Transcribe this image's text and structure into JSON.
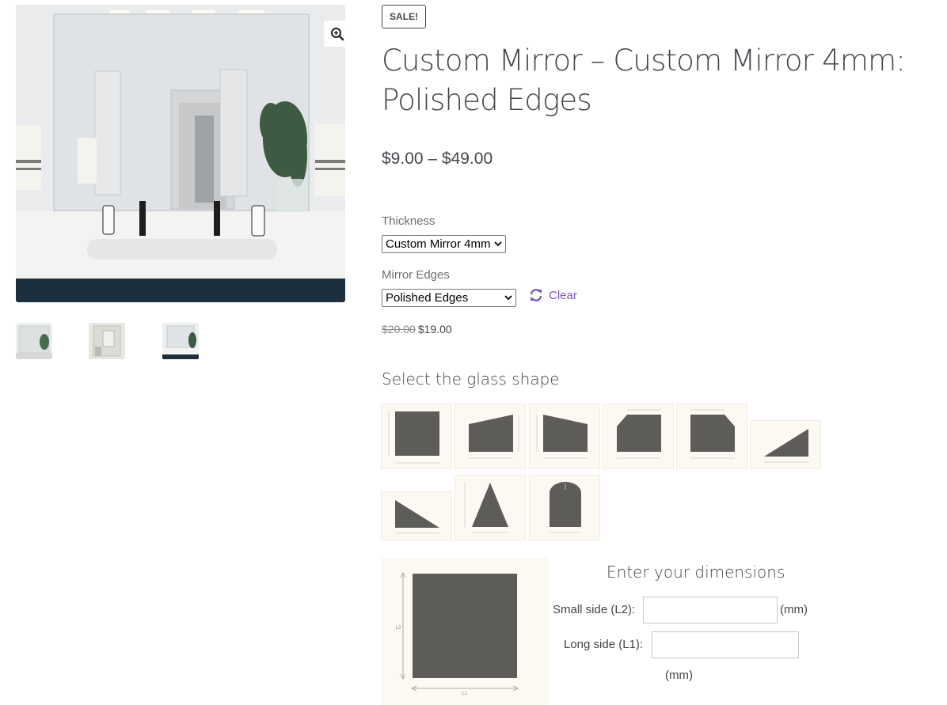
{
  "gallery": {
    "zoom_icon": "magnifier-plus-icon",
    "thumbnail_count": 3
  },
  "product": {
    "badge": "SALE!",
    "title": "Custom Mirror – Custom Mirror 4mm: Polished Edges",
    "price_range": "$9.00 – $49.00",
    "thickness_label": "Thickness",
    "thickness_value": "Custom Mirror 4mm",
    "edges_label": "Mirror Edges",
    "edges_value": "Polished Edges",
    "clear_label": "Clear",
    "clear_icon": "refresh-icon",
    "old_price": "$20.00",
    "new_price": "$19.00"
  },
  "shapes": {
    "heading": "Select the glass shape",
    "items": [
      "square",
      "trapezoid-left",
      "trapezoid-right",
      "cut-corner-left",
      "cut-corners-both",
      "triangle-right",
      "triangle-left",
      "triangle-isosceles",
      "arched"
    ]
  },
  "diagram": {
    "l1_label": "L1",
    "l2_label": "L2"
  },
  "dimensions": {
    "heading": "Enter your dimensions",
    "small_side_label": "Small side (L2):",
    "small_side_value": "",
    "long_side_label": "Long side (L1):",
    "long_side_value": "",
    "unit": "(mm)"
  },
  "colors": {
    "accent": "#7f54b3",
    "shape_fill": "#5d5c58",
    "tile_bg": "#fcf8f2",
    "text": "#43454b"
  }
}
